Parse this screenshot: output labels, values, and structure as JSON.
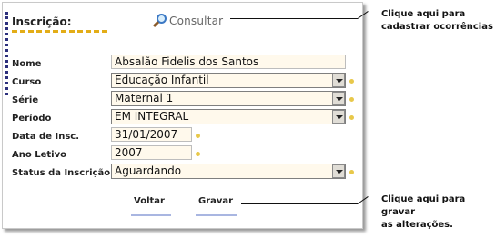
{
  "form": {
    "title": "Inscrição:",
    "consultar": "Consultar",
    "fields": {
      "nome": {
        "label": "Nome",
        "value": "Absalão Fidelis dos Santos"
      },
      "curso": {
        "label": "Curso",
        "value": "Educação Infantil"
      },
      "serie": {
        "label": "Série",
        "value": "Maternal 1"
      },
      "periodo": {
        "label": "Período",
        "value": "EM INTEGRAL"
      },
      "data_insc": {
        "label": "Data de Insc.",
        "value": "31/01/2007"
      },
      "ano_letivo": {
        "label": "Ano Letivo",
        "value": "2007"
      },
      "status": {
        "label": "Status da Inscrição",
        "value": "Aguardando"
      }
    },
    "buttons": {
      "voltar": "Voltar",
      "gravar": "Gravar"
    }
  },
  "callouts": {
    "consultar_line1": "Clique aqui para",
    "consultar_line2": "cadastrar ocorrências",
    "gravar_line1": "Clique aqui para gravar",
    "gravar_line2": "as alterações."
  },
  "icons": {
    "consultar": "magnifier-icon",
    "select_arrow": "chevron-down-icon",
    "required": "dot-icon"
  },
  "colors": {
    "field_bg": "#fff9ec",
    "accent_underline": "#e3ad17",
    "required_dot": "#e8c84a",
    "sidebar_dots": "#2c2f7c"
  }
}
